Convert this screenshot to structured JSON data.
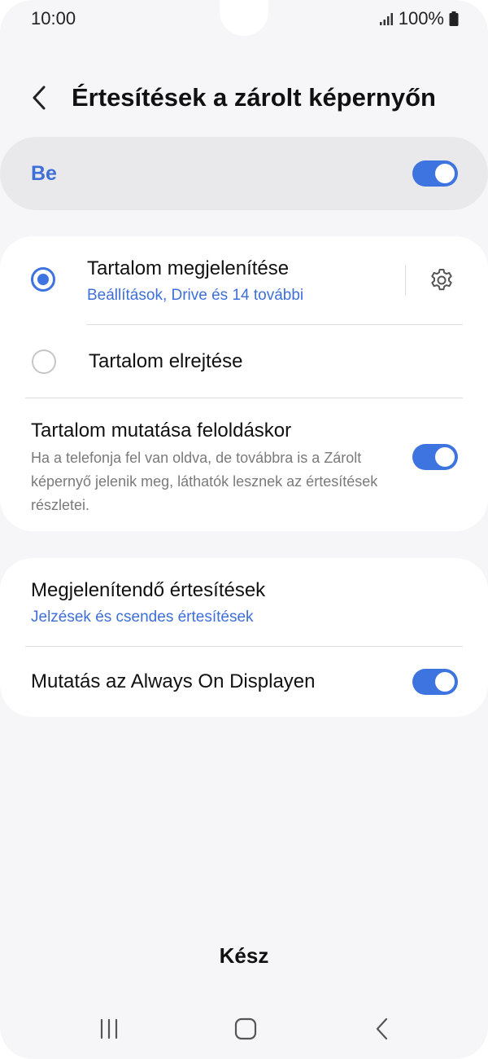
{
  "status_bar": {
    "time": "10:00",
    "battery": "100%"
  },
  "header": {
    "title": "Értesítések a zárolt képernyőn"
  },
  "master": {
    "label": "Be",
    "enabled": true
  },
  "content_options": {
    "show": {
      "title": "Tartalom megjelenítése",
      "subtitle": "Beállítások, Drive és 14 további",
      "selected": true
    },
    "hide": {
      "title": "Tartalom elrejtése",
      "selected": false
    }
  },
  "unlock_setting": {
    "title": "Tartalom mutatása feloldáskor",
    "description": "Ha a telefonja fel van oldva, de továbbra is a Zárolt képernyő jelenik meg, láthatók lesznek az értesítések részletei.",
    "enabled": true
  },
  "notifications_to_show": {
    "title": "Megjelenítendő értesítések",
    "subtitle": "Jelzések és csendes értesítések"
  },
  "aod_setting": {
    "title": "Mutatás az Always On Displayen",
    "enabled": true
  },
  "done_label": "Kész",
  "colors": {
    "accent": "#3e74e0",
    "background": "#f6f6f8",
    "card": "#ffffff"
  }
}
